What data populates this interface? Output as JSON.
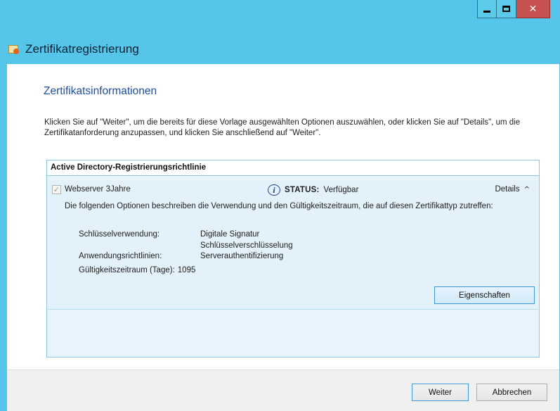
{
  "window": {
    "title": "Zertifikatregistrierung",
    "controls": {
      "minimize": "minimize-icon",
      "maximize": "maximize-icon",
      "close": "close-icon"
    }
  },
  "page": {
    "section_title": "Zertifikatsinformationen",
    "intro": "Klicken Sie auf \"Weiter\", um die bereits für diese Vorlage ausgewählten Optionen auszuwählen, oder klicken Sie auf \"Details\", um die Zertifikatanforderung anzupassen, und klicken Sie anschließend auf \"Weiter\"."
  },
  "policy": {
    "header": "Active Directory-Registrierungsrichtlinie",
    "entry": {
      "name": "Webserver 3Jahre",
      "checked": true,
      "status_label": "STATUS:",
      "status_value": "Verfügbar",
      "details_label": "Details",
      "description": "Die folgenden Optionen beschreiben die Verwendung und den Gültigkeitszeitraum, die auf diesen Zertifikattyp zutreffen:",
      "key_usage_label": "Schlüsselverwendung:",
      "key_usage_values": [
        "Digitale Signatur",
        "Schlüsselverschlüsselung"
      ],
      "app_policies_label": "Anwendungsrichtlinien:",
      "app_policies_value": "Serverauthentifizierung",
      "validity_label": "Gültigkeitszeitraum (Tage):",
      "validity_value": "1095",
      "properties_button": "Eigenschaften"
    }
  },
  "footer": {
    "next_button": "Weiter",
    "cancel_button": "Abbrechen"
  },
  "colors": {
    "titlebar": "#55c6ea",
    "close_button": "#c75050",
    "accent_blue": "#1f4e9c",
    "panel_border": "#8ec6dd",
    "entry_background": "#e3f1fa"
  }
}
